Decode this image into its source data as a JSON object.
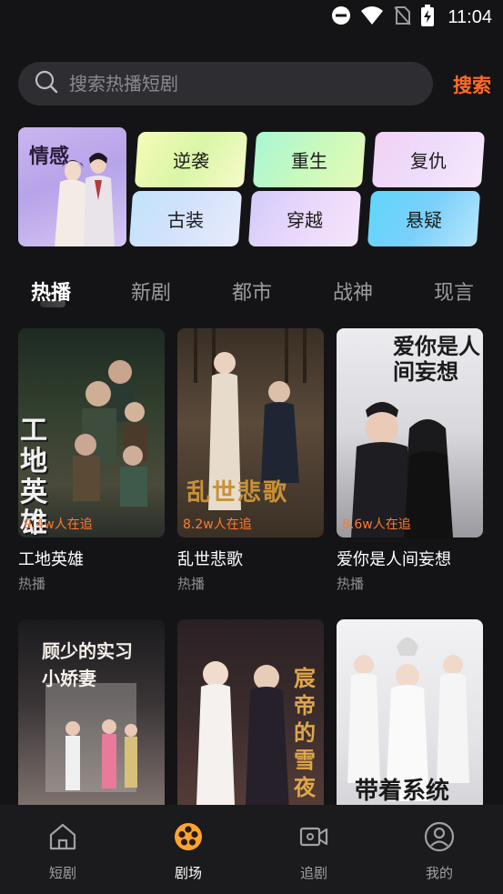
{
  "status_bar": {
    "time": "11:04",
    "icons": [
      "dnd-icon",
      "wifi-icon",
      "no-sim-icon",
      "battery-icon"
    ]
  },
  "search": {
    "placeholder": "搜索热播短剧",
    "button_label": "搜索"
  },
  "categories": {
    "feature": {
      "label": "情感"
    },
    "chips": [
      {
        "label": "逆袭"
      },
      {
        "label": "重生"
      },
      {
        "label": "复仇"
      },
      {
        "label": "古装"
      },
      {
        "label": "穿越"
      },
      {
        "label": "悬疑"
      }
    ]
  },
  "tabs": [
    {
      "label": "热播",
      "active": true
    },
    {
      "label": "新剧"
    },
    {
      "label": "都市"
    },
    {
      "label": "战神"
    },
    {
      "label": "现言"
    }
  ],
  "dramas": [
    {
      "title": "工地英雄",
      "tag": "热播",
      "watchers": "9.4w人在追",
      "poster_text": "工地英雄"
    },
    {
      "title": "乱世悲歌",
      "tag": "热播",
      "watchers": "8.2w人在追",
      "poster_text": "乱世悲歌"
    },
    {
      "title": "爱你是人间妄想",
      "tag": "热播",
      "watchers": "8.6w人在追",
      "poster_text": "爱你是人间妄想"
    },
    {
      "title": "",
      "tag": "",
      "watchers": "",
      "poster_text": "顾少的实习小娇妻"
    },
    {
      "title": "",
      "tag": "",
      "watchers": "",
      "poster_text": "宸帝的雪夜"
    },
    {
      "title": "",
      "tag": "",
      "watchers": "",
      "poster_text": "带着系统"
    }
  ],
  "bottom_nav": [
    {
      "label": "短剧",
      "icon": "home-icon"
    },
    {
      "label": "剧场",
      "icon": "film-reel-icon",
      "active": true
    },
    {
      "label": "追剧",
      "icon": "video-camera-icon"
    },
    {
      "label": "我的",
      "icon": "profile-icon"
    }
  ],
  "colors": {
    "accent": "#ff6a2a",
    "watch_count": "#ff7a2e",
    "background": "#141416"
  }
}
